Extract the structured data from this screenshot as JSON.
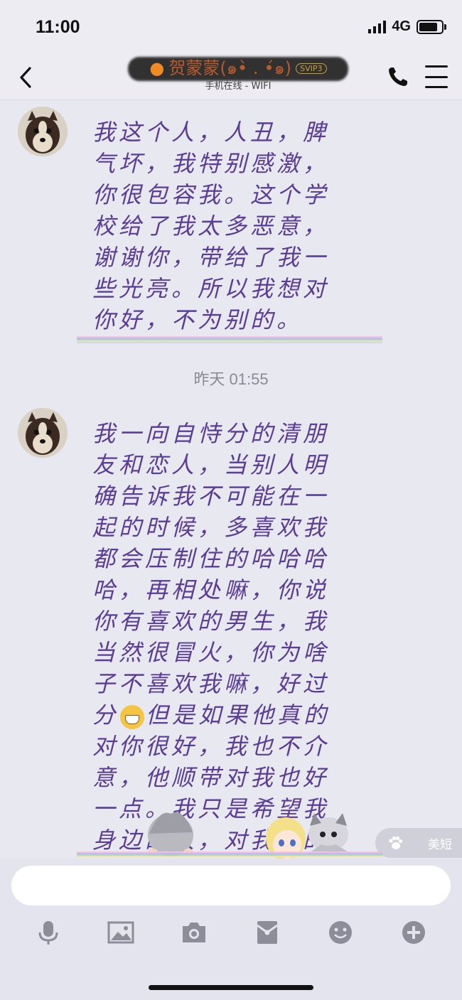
{
  "status_bar": {
    "time": "11:00",
    "network": "4G",
    "battery_level": 0.9
  },
  "nav": {
    "contact_name": "贺蒙蒙(๑•̀ ․ •́๑)",
    "vip_badge": "SVIP3",
    "status": "手机在线 - WIFI"
  },
  "messages": [
    {
      "text": "我这个人，人丑，脾气坏，我特别感激，你很包容我。这个学校给了我太多恶意，谢谢你，带给了我一些光亮。所以我想对你好，不为别的。"
    },
    {
      "timestamp": "昨天 01:55"
    },
    {
      "text_before_emoji": "我一向自恃分的清朋友和恋人，当别人明确告诉我不可能在一起的时候，多喜欢我都会压制住的哈哈哈哈，再相处嘛，你说你有喜欢的男生，我当然很冒火，你为啥子不喜欢我嘛，好过分",
      "text_after_emoji": "但是如果他真的对你很好，我也不介意，他顺带对我也好一点。我只是希望我身边的人，对我好的人，我能对你也好。"
    }
  ],
  "tag_button": {
    "label": "美短"
  },
  "colors": {
    "message_text": "#5a3d96",
    "background": "#e8e8f1",
    "accent_flame": "#f08a24"
  }
}
